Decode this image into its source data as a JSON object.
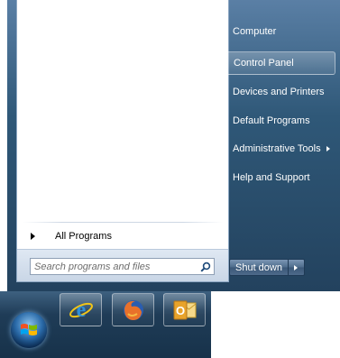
{
  "start_menu": {
    "all_programs_label": "All Programs",
    "search_placeholder": "Search programs and files",
    "right_items": [
      {
        "label": "Computer"
      },
      {
        "label": "Control Panel"
      },
      {
        "label": "Devices and Printers"
      },
      {
        "label": "Default Programs"
      },
      {
        "label": "Administrative Tools"
      },
      {
        "label": "Help and Support"
      }
    ],
    "shutdown_label": "Shut down"
  },
  "taskbar": {
    "pinned_apps": [
      {
        "icon": "internet-explorer-icon"
      },
      {
        "icon": "firefox-icon"
      },
      {
        "icon": "outlook-icon"
      }
    ]
  },
  "colors": {
    "menu_blue": "#2f5878",
    "taskbar_blue": "#1f3c57",
    "highlight": "#ffffff"
  }
}
